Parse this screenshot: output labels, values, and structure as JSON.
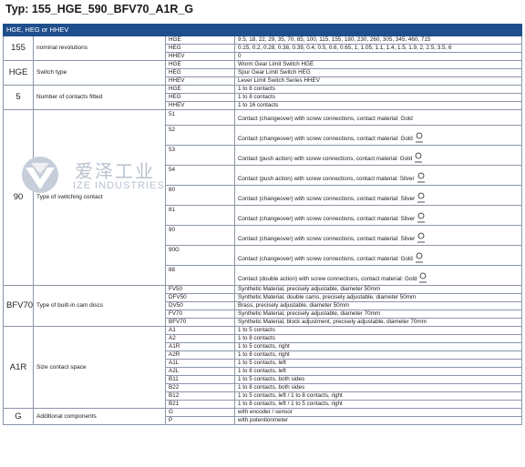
{
  "title": "Typ:  155_HGE_590_BFV70_A1R_G",
  "header": "HGE, HEG or HHEV",
  "watermark": {
    "cn": "爱泽工业",
    "en": "IZE INDUSTRIES"
  },
  "groups": {
    "rev": {
      "code": "155",
      "desc": "nominal revolutions",
      "rows": [
        [
          "HGE",
          "9.5, 18, 22, 29, 35, 70, 85, 100, 115, 155, 180, 230, 260, 305, 345, 460, 715"
        ],
        [
          "HEG",
          "0.15, 0.2, 0.28, 0.38, 0.39, 0.4, 0.5, 0.6, 0.65, 1, 1.05, 1.1, 1.4, 1.5, 1.9, 2, 2.5, 3.5, 6"
        ],
        [
          "HHEV",
          "0"
        ]
      ]
    },
    "switch": {
      "code": "HGE",
      "desc": "Switch type",
      "rows": [
        [
          "HGE",
          "Worm Gear Limit Switch HGE"
        ],
        [
          "HEG",
          "Spur Gear Limit Switch HEG"
        ],
        [
          "HHEV",
          "Lever Limit Switch Series HHEV"
        ]
      ]
    },
    "contacts": {
      "code": "5",
      "desc": "Number of contacts fitted",
      "rows": [
        [
          "HGE",
          "1 to 8 contacts"
        ],
        [
          "HEG",
          "1 to 8 contacts"
        ],
        [
          "HHEV",
          "1 to 16 contacts"
        ]
      ]
    },
    "swc": {
      "code": "90",
      "desc": "Type of switching contact",
      "rows": [
        [
          "51",
          "Contact (changeover) with screw connections, contact material: Gold"
        ],
        [
          "52",
          "Contact (changeover) with screw connections, contact material: Gold"
        ],
        [
          "53",
          "Contact (push action) with screw connections, contact material: Gold"
        ],
        [
          "54",
          "Contact (push action) with screw connections, contact material: Silver"
        ],
        [
          "80",
          "Contact (changeover) with screw connections, contact material: Silver"
        ],
        [
          "81",
          "Contact (changeover) with screw connections, contact material: Silver"
        ],
        [
          "90",
          "Contact (changeover) with screw connections, contact material: Silver"
        ],
        [
          "90G",
          "Contact (changeover) with screw connections, contact material: Gold"
        ],
        [
          "88",
          "Contact (double action) with screw connections, contact material: Gold"
        ]
      ]
    },
    "cam": {
      "code": "BFV70",
      "desc": "Type of built-in cam discs",
      "rows": [
        [
          "FV50",
          "Synthetic Material, precisely adjustable, diameter 50mm"
        ],
        [
          "DFV50",
          "Synthetic Material, double cams, precisely adjustable, diameter 50mm"
        ],
        [
          "DV50",
          "Brass, precisely adjustable, diameter 50mm"
        ],
        [
          "FV70",
          "Synthetic Material, precisely adjustable, diameter 70mm"
        ],
        [
          "BFV70",
          "Synthetic Material, block adjustment, precisely adjustable, diameter 70mm"
        ]
      ]
    },
    "size": {
      "code": "A1R",
      "desc": "Size contact space",
      "rows": [
        [
          "A1",
          "1 to 5 contacts"
        ],
        [
          "A2",
          "1 to 8 contacts"
        ],
        [
          "A1R",
          "1 to 5 contacts, right"
        ],
        [
          "A2R",
          "1 to 8 contacts, right"
        ],
        [
          "A1L",
          "1 to 5 contacts, left"
        ],
        [
          "A2L",
          "1 to 8 contacts, left"
        ],
        [
          "B11",
          "1 to 5 contacts, both sides"
        ],
        [
          "B22",
          "1 to 8 contacts, both sides"
        ],
        [
          "B12",
          "1 to 5 contacts, left / 1 to 8 contacts, right"
        ],
        [
          "B21",
          "1 to 8 contacts, left / 1 to 5 contacts, right"
        ]
      ]
    },
    "add": {
      "code": "G",
      "desc": "Additional components",
      "rows": [
        [
          "G",
          "with encoder / sensor"
        ],
        [
          "P",
          "with potentionmeter"
        ]
      ]
    }
  }
}
